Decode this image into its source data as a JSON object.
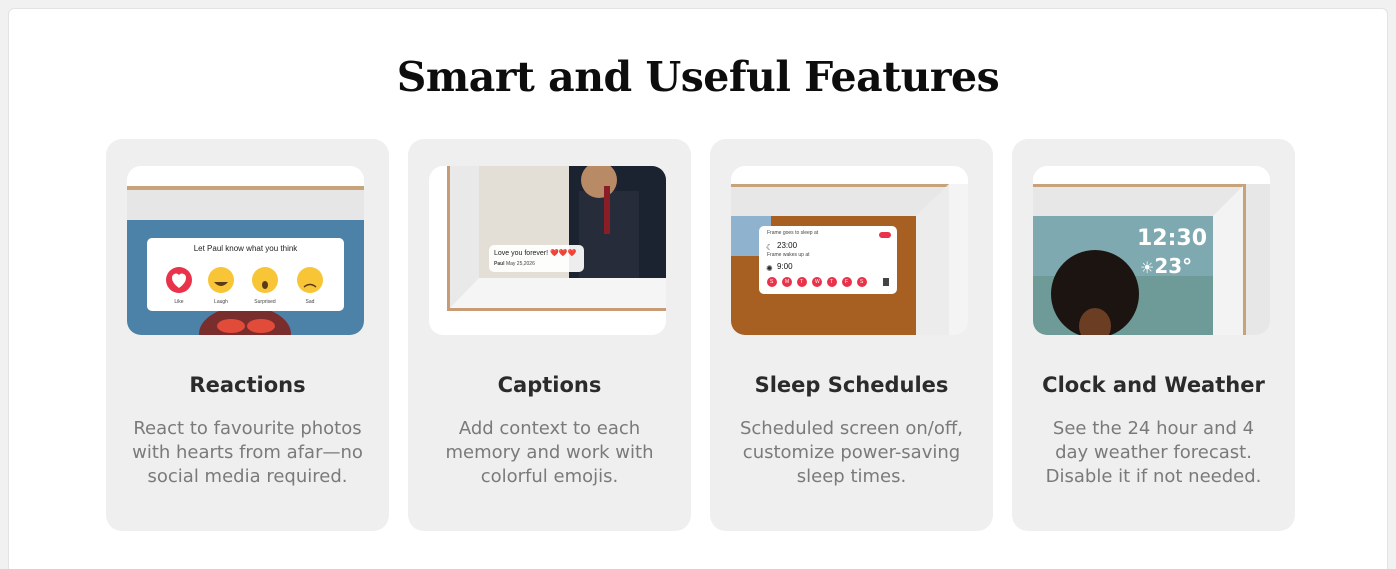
{
  "section": {
    "title": "Smart and Useful Features"
  },
  "cards": [
    {
      "title": "Reactions",
      "description": "React to favourite photos with hearts from afar—no social media required.",
      "popup_title": "Let Paul know what you think",
      "reactions": [
        "Like",
        "Laugh",
        "Surprised",
        "Sad"
      ]
    },
    {
      "title": "Captions",
      "description": "Add context to each memory and work with colorful emojis.",
      "caption_text": "Love you forever! ❤️❤️❤️",
      "caption_author": "Paul",
      "caption_date": "May 25,2026"
    },
    {
      "title": "Sleep Schedules",
      "description": "Scheduled screen on/off, customize power-saving sleep times.",
      "sleep_label": "Frame goes to sleep at",
      "sleep_time": "23:00",
      "wake_label": "Frame wakes up at",
      "wake_time": "9:00",
      "days": [
        "S",
        "M",
        "T",
        "W",
        "T",
        "F",
        "S"
      ]
    },
    {
      "title": "Clock and Weather",
      "description": "See the 24 hour and 4 day weather forecast. Disable it if not needed.",
      "clock_time": "12:30",
      "temperature": "23°"
    }
  ],
  "colors": {
    "accent_red": "#e8334a",
    "card_bg": "#efefef",
    "sky": "#4c82a8"
  }
}
